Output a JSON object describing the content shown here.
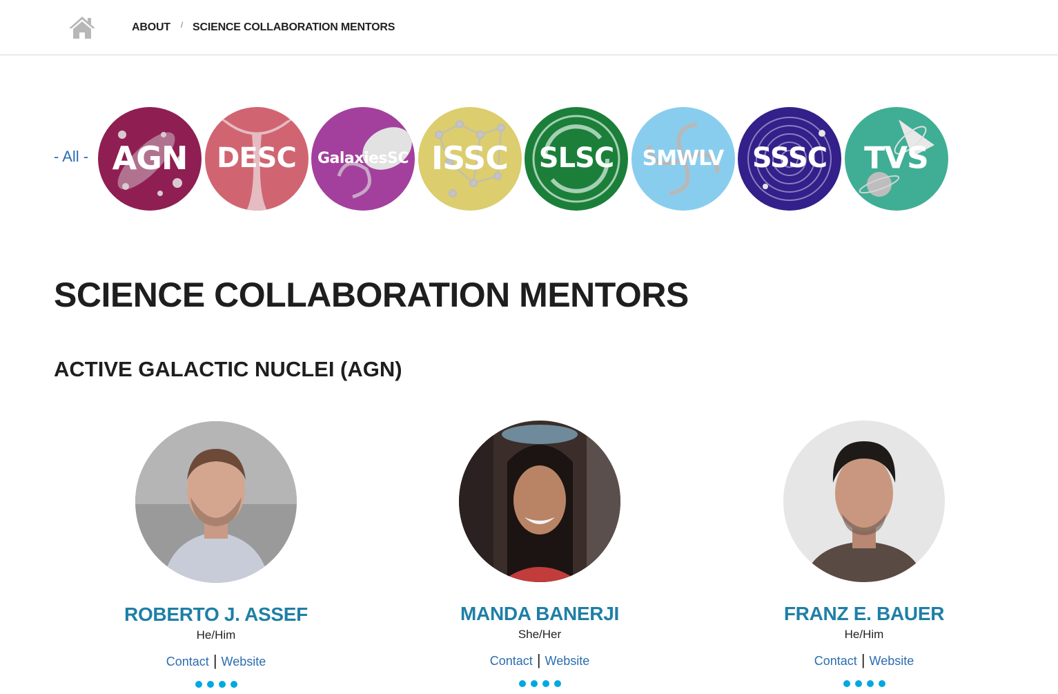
{
  "breadcrumb": {
    "items": [
      {
        "label": "ABOUT"
      },
      {
        "label": "SCIENCE COLLABORATION MENTORS"
      }
    ],
    "separator": "/"
  },
  "filter": {
    "all_label": "- All -",
    "badges": [
      {
        "label": "AGN",
        "color": "#8f1f52"
      },
      {
        "label": "DESC",
        "color": "#d06571"
      },
      {
        "label": "GalaxiesSC",
        "color": "#a3409d"
      },
      {
        "label": "ISSC",
        "color": "#dccd6e"
      },
      {
        "label": "SLSC",
        "color": "#1b7f3a"
      },
      {
        "label": "SMWLV",
        "color": "#89cdee"
      },
      {
        "label": "SSSC",
        "color": "#33208a"
      },
      {
        "label": "TVS",
        "color": "#3fae94"
      }
    ]
  },
  "main": {
    "title": "SCIENCE COLLABORATION MENTORS",
    "section_title": "ACTIVE GALACTIC NUCLEI (AGN)",
    "mentors": [
      {
        "name": "ROBERTO J. ASSEF",
        "pronouns": "He/Him",
        "contact_label": "Contact",
        "website_label": "Website",
        "dot_count": 4
      },
      {
        "name": "MANDA BANERJI",
        "pronouns": "She/Her",
        "contact_label": "Contact",
        "website_label": "Website",
        "dot_count": 4
      },
      {
        "name": "FRANZ E. BAUER",
        "pronouns": "He/Him",
        "contact_label": "Contact",
        "website_label": "Website",
        "dot_count": 4
      }
    ]
  },
  "colors": {
    "link": "#2a6db0",
    "name": "#1f7fa6",
    "dot": "#00a8e1"
  }
}
